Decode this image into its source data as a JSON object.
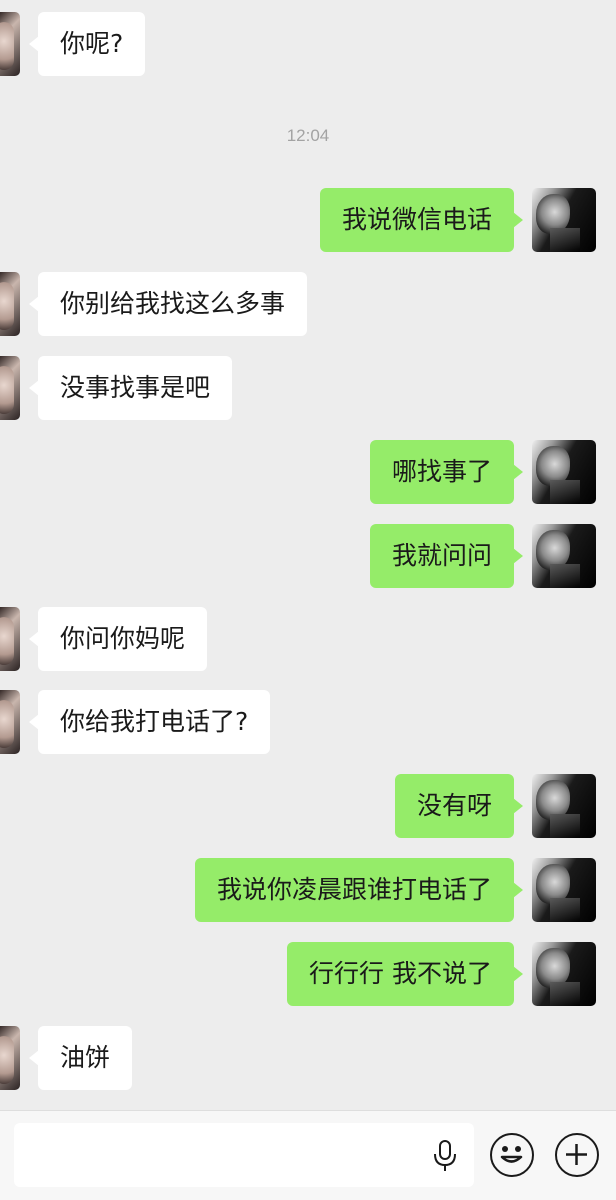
{
  "chat": {
    "timestamp": "12:04",
    "messages": [
      {
        "from": "them",
        "text": "你呢?"
      },
      {
        "from": "me",
        "text": "我说微信电话"
      },
      {
        "from": "them",
        "text": "你别给我找这么多事"
      },
      {
        "from": "them",
        "text": "没事找事是吧"
      },
      {
        "from": "me",
        "text": "哪找事了"
      },
      {
        "from": "me",
        "text": "我就问问"
      },
      {
        "from": "them",
        "text": "你问你妈呢"
      },
      {
        "from": "them",
        "text": "你给我打电话了?"
      },
      {
        "from": "me",
        "text": "没有呀"
      },
      {
        "from": "me",
        "text": "我说你凌晨跟谁打电话了"
      },
      {
        "from": "me",
        "text": "行行行 我不说了"
      },
      {
        "from": "them",
        "text": "油饼"
      }
    ]
  },
  "input_bar": {
    "value": "",
    "placeholder": "",
    "icons": [
      "microphone-icon",
      "emoji-icon",
      "plus-icon"
    ]
  },
  "colors": {
    "background": "#ededed",
    "my_bubble": "#95ec69",
    "their_bubble": "#ffffff",
    "timestamp_text": "#a3a3a3"
  }
}
